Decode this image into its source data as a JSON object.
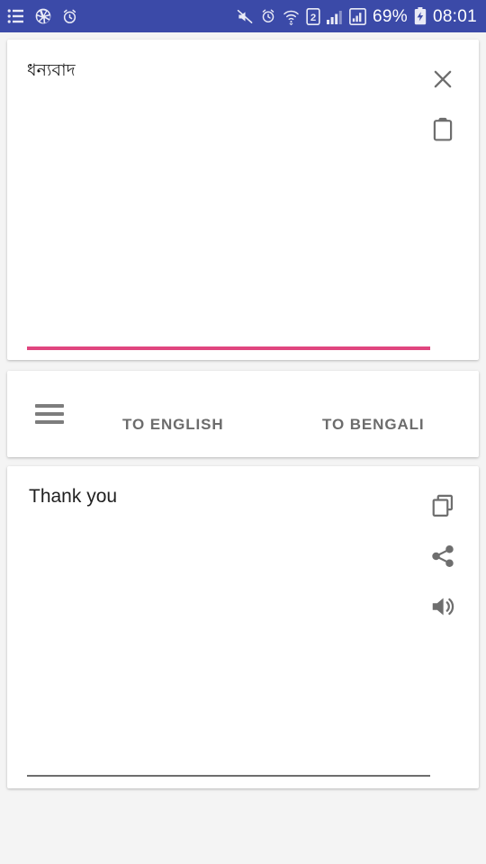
{
  "status_bar": {
    "background_color": "#3b4aa8",
    "left_icons": [
      {
        "name": "list-icon",
        "glyph": "list"
      },
      {
        "name": "camera-aperture-icon",
        "glyph": "aperture"
      },
      {
        "name": "alarm-clock-icon",
        "glyph": "alarm"
      }
    ],
    "right_icons": [
      {
        "name": "mute-icon",
        "glyph": "mute"
      },
      {
        "name": "alarm-clock-icon",
        "glyph": "alarm"
      },
      {
        "name": "wifi-icon",
        "glyph": "wifi"
      },
      {
        "name": "sim2-icon",
        "glyph": "sim",
        "label": "2"
      },
      {
        "name": "signal-bars-icon",
        "glyph": "signal"
      },
      {
        "name": "signal-boxed-icon",
        "glyph": "signal-box"
      }
    ],
    "battery_percent": "69%",
    "battery_icon": "battery-charging-icon",
    "clock": "08:01"
  },
  "source_card": {
    "text": "ধন্যবাদ",
    "placeholder": "",
    "underline_color": "#e0457f",
    "actions": [
      {
        "name": "close-icon",
        "label": "Clear"
      },
      {
        "name": "clipboard-paste-icon",
        "label": "Paste"
      }
    ]
  },
  "language_bar": {
    "menu_label": "Menu",
    "to_english_label": "TO ENGLISH",
    "to_bengali_label": "TO BENGALI"
  },
  "result_card": {
    "text": "Thank you",
    "underline_color": "#6d6d6d",
    "actions": [
      {
        "name": "copy-icon",
        "label": "Copy"
      },
      {
        "name": "share-icon",
        "label": "Share"
      },
      {
        "name": "volume-speaker-icon",
        "label": "Speak"
      }
    ]
  }
}
